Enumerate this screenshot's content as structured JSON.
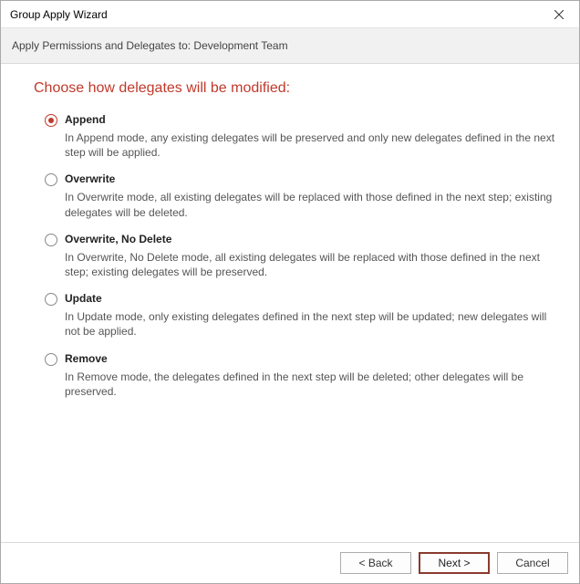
{
  "window": {
    "title": "Group Apply Wizard",
    "subtitle": "Apply Permissions and Delegates to: Development Team"
  },
  "heading": "Choose how delegates will be modified:",
  "options": [
    {
      "label": "Append",
      "description": "In Append mode, any existing delegates will be preserved and only new delegates defined in the next step will be applied.",
      "selected": true
    },
    {
      "label": "Overwrite",
      "description": "In Overwrite mode, all existing delegates will be replaced with those defined in the next step; existing delegates will be deleted.",
      "selected": false
    },
    {
      "label": "Overwrite, No Delete",
      "description": "In Overwrite, No Delete mode, all existing delegates will be replaced with those defined in the next step; existing delegates will be preserved.",
      "selected": false
    },
    {
      "label": "Update",
      "description": "In Update mode, only existing delegates defined in the next step will be updated; new delegates will not be applied.",
      "selected": false
    },
    {
      "label": "Remove",
      "description": "In Remove mode, the delegates defined in the next step will be deleted; other delegates will be preserved.",
      "selected": false
    }
  ],
  "footer": {
    "back": "< Back",
    "next": "Next >",
    "cancel": "Cancel"
  }
}
